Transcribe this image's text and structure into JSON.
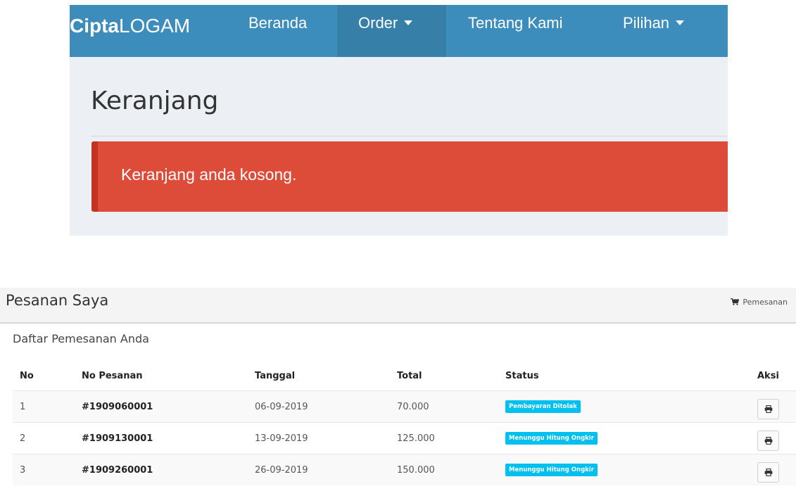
{
  "navbar": {
    "brand_bold": "Cipta",
    "brand_rest": "LOGAM",
    "items": [
      {
        "label": "Beranda",
        "dropdown": false,
        "active": false
      },
      {
        "label": "Order",
        "dropdown": true,
        "active": true
      },
      {
        "label": "Tentang Kami",
        "dropdown": false,
        "active": false
      },
      {
        "label": "Pilihan",
        "dropdown": true,
        "active": false
      }
    ],
    "colors": {
      "bar": "#3c8dbc",
      "active": "#367fa9"
    }
  },
  "cart": {
    "heading": "Keranjang",
    "alert_text": "Keranjang anda kosong.",
    "alert_color": "#dd4b39"
  },
  "orders": {
    "title": "Pesanan Saya",
    "breadcrumb_icon": "shopping-cart-icon",
    "breadcrumb_label": "Pemesanan",
    "subtitle": "Daftar Pemesanan Anda",
    "columns": [
      "No",
      "No Pesanan",
      "Tanggal",
      "Total",
      "Status",
      "Aksi"
    ],
    "rows": [
      {
        "no": "1",
        "order_no": "#1909060001",
        "date": "06-09-2019",
        "total": "70.000",
        "status": "Pembayaran Ditolak",
        "action_icon": "print-icon"
      },
      {
        "no": "2",
        "order_no": "#1909130001",
        "date": "13-09-2019",
        "total": "125.000",
        "status": "Menunggu Hitung Ongkir",
        "action_icon": "print-icon"
      },
      {
        "no": "3",
        "order_no": "#1909260001",
        "date": "26-09-2019",
        "total": "150.000",
        "status": "Menunggu Hitung Ongkir",
        "action_icon": "print-icon"
      }
    ],
    "status_color": "#00c0ef"
  }
}
